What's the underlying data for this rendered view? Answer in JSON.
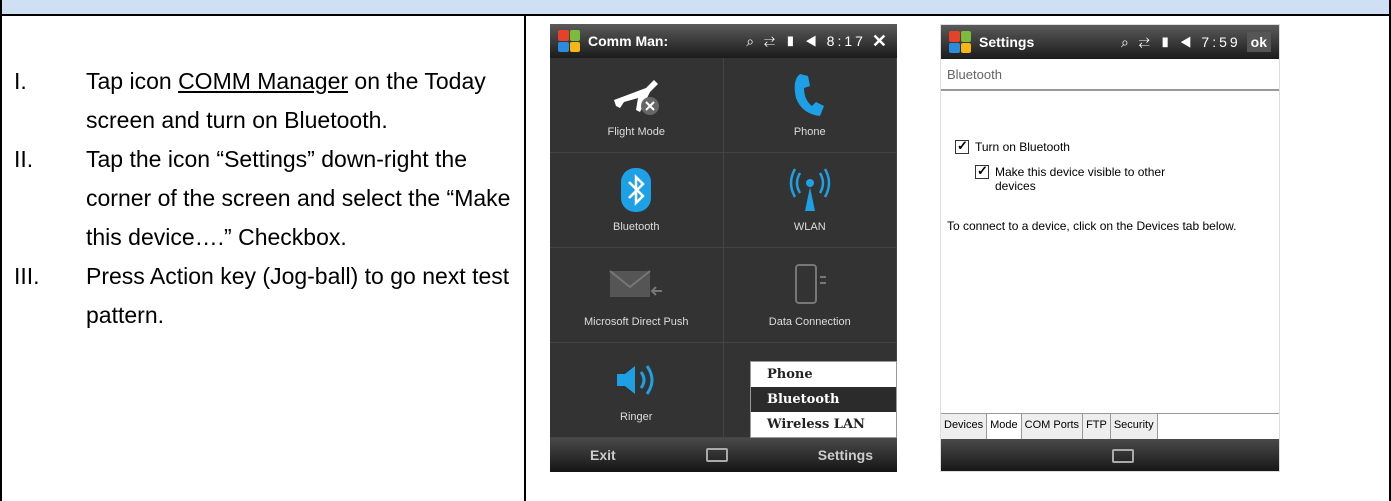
{
  "steps": [
    {
      "num": "I.",
      "pre": "Tap icon ",
      "link": "COMM Manager",
      "post": " on the Today screen and turn on Bluetooth."
    },
    {
      "num": "II.",
      "text": "Tap the icon “Settings” down-right the corner of the screen and select the “Make this device….” Checkbox."
    },
    {
      "num": "III.",
      "text": "Press Action key (Jog-ball) to go next test pattern."
    }
  ],
  "phone1": {
    "title": "Comm Man:",
    "status": "⌕ ⇄ ▮ ◀ 8:17",
    "close": "✕",
    "tiles": [
      "Flight Mode",
      "Phone",
      "Bluetooth",
      "WLAN",
      "Microsoft Direct Push",
      "Data Connection",
      "Ringer",
      ""
    ],
    "popup": [
      "Phone",
      "Bluetooth",
      "Wireless LAN"
    ],
    "exit": "Exit",
    "settings": "Settings"
  },
  "phone2": {
    "title": "Settings",
    "status": "⌕ ⇄ ▮ ◀ 7:59",
    "ok": "ok",
    "section": "Bluetooth",
    "cb1": "Turn on Bluetooth",
    "cb2": "Make this device visible to other devices",
    "info": "To connect to a device, click on the Devices tab below.",
    "tabs": [
      "Devices",
      "Mode",
      "COM Ports",
      "FTP",
      "Security"
    ]
  },
  "colors": {
    "header_band": "#cfe0f5",
    "accent_blue": "#1ea0e6"
  }
}
